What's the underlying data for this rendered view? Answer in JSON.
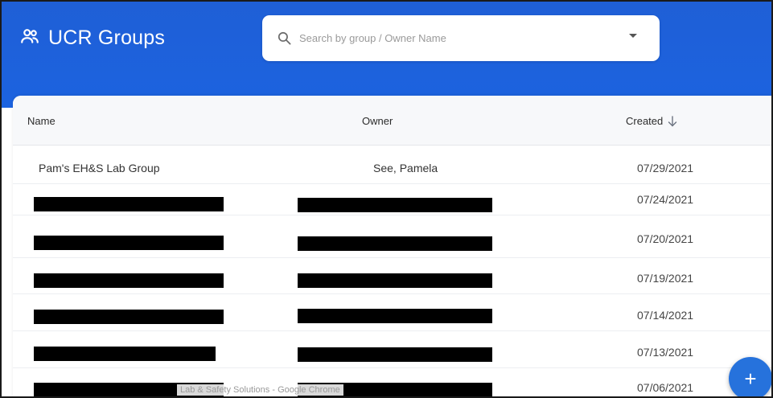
{
  "app": {
    "title": "UCR Groups",
    "icon": "people-icon",
    "accent_color": "#1c63e0"
  },
  "search": {
    "placeholder": "Search by group / Owner Name",
    "icon": "search-icon",
    "dropdown_icon": "chevron-down-icon"
  },
  "table": {
    "columns": {
      "name": "Name",
      "owner": "Owner",
      "created": "Created"
    },
    "sort": {
      "column": "created",
      "direction": "descending",
      "icon": "arrow-down-icon"
    },
    "rows": [
      {
        "name": "Pam's EH&S Lab Group",
        "owner": "See, Pamela",
        "created": "07/29/2021"
      },
      {
        "name": "",
        "owner": "",
        "created": "07/24/2021"
      },
      {
        "name": "",
        "owner": "",
        "created": "07/20/2021"
      },
      {
        "name": "",
        "owner": "",
        "created": "07/19/2021"
      },
      {
        "name": "",
        "owner": "",
        "created": "07/14/2021"
      },
      {
        "name": "",
        "owner": "",
        "created": "07/13/2021"
      },
      {
        "name": "",
        "owner": "",
        "created": "07/06/2021"
      }
    ]
  },
  "fab": {
    "label": "+",
    "icon": "plus-icon"
  },
  "tooltip": {
    "text": "Lab & Safety Solutions - Google Chrome"
  }
}
